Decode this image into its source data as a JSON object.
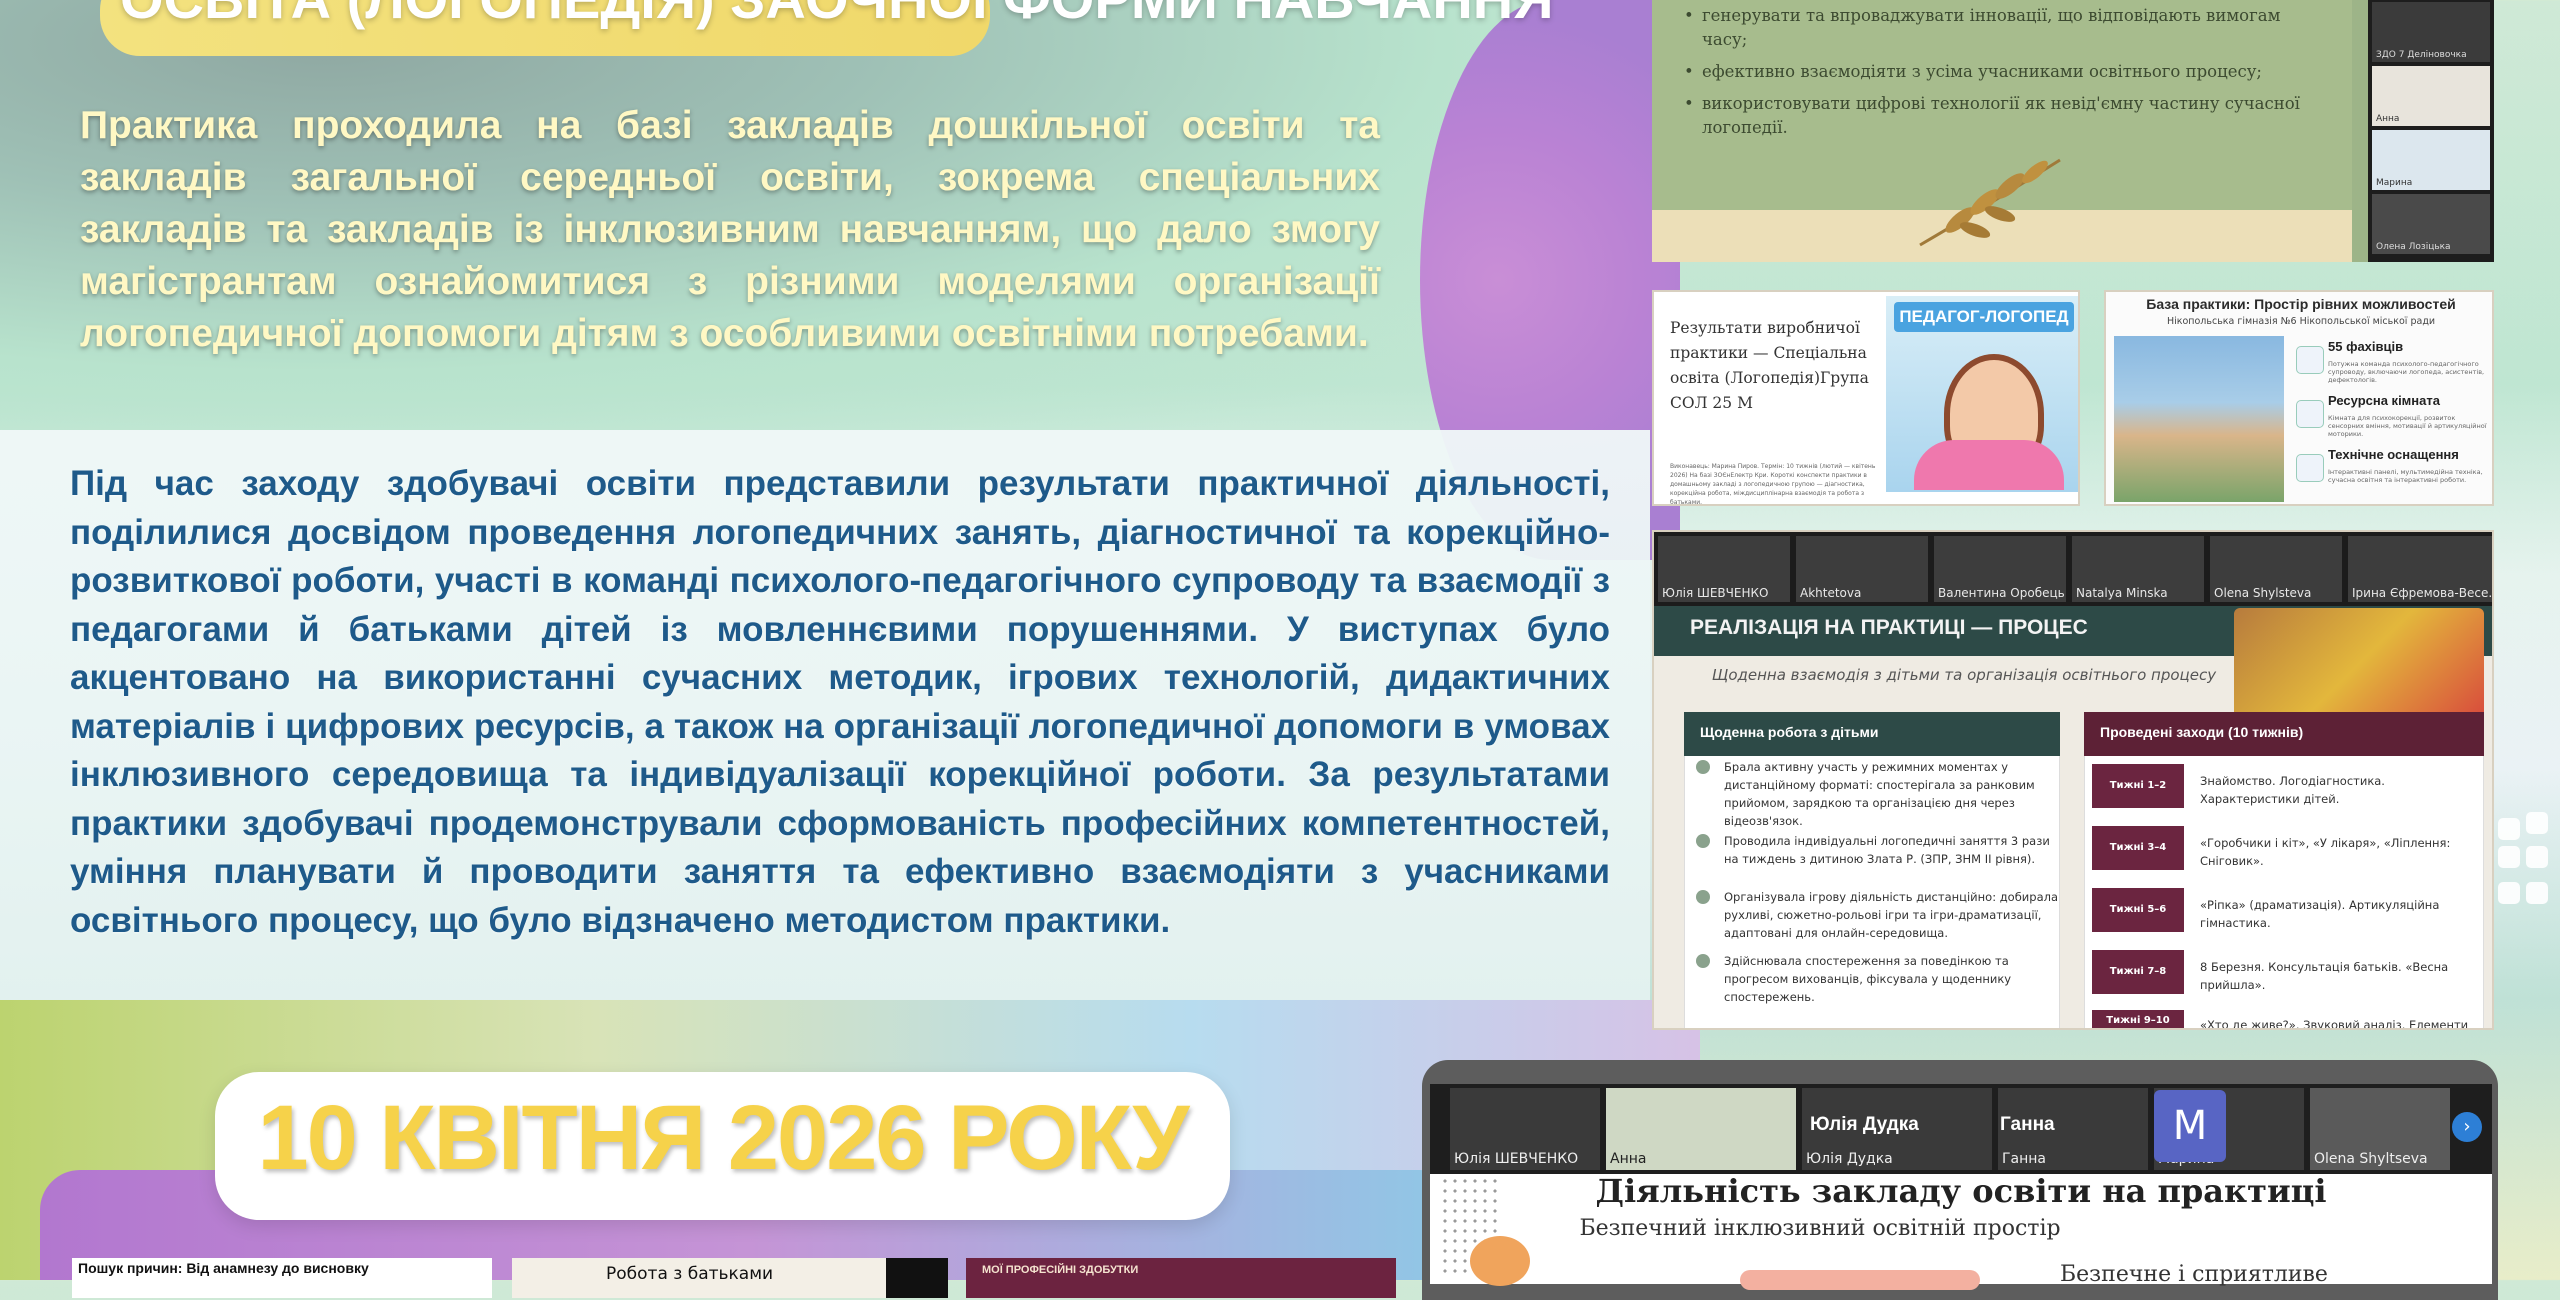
{
  "header": {
    "title": "ОСВІТА (ЛОГОПЕДІЯ) ЗАОЧНОЇ ФОРМИ НАВЧАННЯ",
    "intro": "Практика проходила на базі закладів дошкільної освіти та закладів загальної середньої освіти, зокрема спеціальних закладів та закладів із інклюзивним навчанням, що дало змогу магістрантам ознайомитися з різними моделями організації логопедичної допомоги дітям з особливими освітніми потребами."
  },
  "main": {
    "text": "Під час заходу здобувачі освіти представили результати практичної діяльності, поділилися досвідом проведення логопедичних занять, діагностичної та корекційно-розвиткової роботи, участі в команді психолого-педагогічного супроводу та взаємодії з педагогами й батьками дітей із мовленнєвими порушеннями. У виступах було акцентовано на використанні сучасних методик, ігрових технологій, дидактичних матеріалів і цифрових ресурсів, а також на організації логопедичної допомоги в умовах інклюзивного середовища та індивідуалізації корекційної роботи. За результатами практики здобувачі продемонстрували сформованість професійних компетентностей, уміння планувати й проводити заняття та ефективно взаємодіяти з учасниками освітнього процесу, що було відзначено методистом практики."
  },
  "date": "10 КВІТНЯ 2026 РОКУ",
  "slide1": {
    "bullets": [
      "генерувати та впроваджувати інновації, що відповідають вимогам часу;",
      "ефективно взаємодіяти з усіма учасниками освітнього процесу;",
      "використовувати цифрові технології як невід'ємну частину сучасної логопедії."
    ],
    "participants": [
      "ЗДО 7 Деліновочка",
      "Анна",
      "Марина",
      "Олена Лозіцька"
    ]
  },
  "slide2": {
    "text": "Результати виробничої практики — Спеціальна освіта (Логопедія)Група СОЛ 25 М",
    "small": "Виконавець: Марина Пиров. Термін: 10 тижнів (лютий — квітень 2026) На базі ЗОЄнЕлектр Кри. Короткі конспекти практики в домашньому закладі з логопедичною групою — діагностика, корекційна робота, міждисциплінарна взаємодія та робота з батьками.",
    "image_label": "ПЕДАГОГ-ЛОГОПЕД"
  },
  "slide3": {
    "title": "База практики: Простір рівних можливостей",
    "subtitle": "Нікопольська гімназія №6 Нікопольської міської ради",
    "rows": [
      {
        "head": "55 фахівців",
        "desc": "Потужна команда психолого-педагогічного супроводу, включаючи логопеда, асистентів, дефектологів."
      },
      {
        "head": "Ресурсна кімната",
        "desc": "Кімната для психокорекції, розвиток сенсорних вміння, мотивації й артикуляційної моторики."
      },
      {
        "head": "Технічне оснащення",
        "desc": "Інтерактивні панелі, мультимедійна техніка, сучасна освітня та інтерактивні роботи."
      }
    ]
  },
  "slide4": {
    "participants": [
      "Юлія ШЕВЧЕНКО",
      "Akhtetova",
      "Валентина Оробець",
      "Natalya Minska",
      "Olena Shylsteva",
      "Ірина Єфремова-Весе..."
    ],
    "heading": "РЕАЛІЗАЦІЯ НА ПРАКТИЦІ — ПРОЦЕС",
    "subheading": "Щоденна взаємодія з дітьми та організація освітнього процесу",
    "left_title": "Щоденна робота з дітьми",
    "left_items": [
      "Брала активну участь у режимних моментах у дистанційному форматі: спостерігала за ранковим прийомом, зарядкою та організацією дня через відеозв'язок.",
      "Проводила індивідуальні логопедичні заняття 3 рази на тиждень з дитиною Злата Р. (ЗПР, ЗНМ ІІ рівня).",
      "Організувала ігрову діяльність дистанційно: добирала рухливі, сюжетно-рольові ігри та ігри-драматизації, адаптовані для онлайн-середовища.",
      "Здійснювала спостереження за поведінкою та прогресом вихованців, фіксувала у щоденнику спостережень."
    ],
    "right_title": "Проведені заходи (10 тижнів)",
    "weeks": [
      {
        "label": "Тижні 1–2",
        "text": "Знайомство. Логодіагностика. Характеристики дітей."
      },
      {
        "label": "Тижні 3–4",
        "text": "«Горобчики і кіт», «У лікаря», «Ліплення: Сніговик»."
      },
      {
        "label": "Тижні 5–6",
        "text": "«Ріпка» (драматизація). Артикуляційна гімнастика."
      },
      {
        "label": "Тижні 7–8",
        "text": "8 Березня. Консультація батьків. «Весна прийшла»."
      },
      {
        "label": "Тижні 9–10",
        "text": "«Хто де живе?». Звуковий аналіз. Елементи"
      }
    ]
  },
  "slide5": {
    "participants": [
      "Юлія ШЕВЧЕНКО",
      "Анна",
      "Юлія Дудка",
      "Ганна",
      "Марина",
      "Olena Shyltseva"
    ],
    "big_names": [
      "Юлія Дудка",
      "Ганна"
    ],
    "avatar_letter": "M",
    "title": "Діяльність закладу освіти на практиці",
    "subtitle": "Безпечний інклюзивний освітній простір",
    "text2": "Безпечне і сприятливе"
  },
  "mini": {
    "m1": "Пошук причин: Від анамнезу до висновку",
    "m2": "Робота з батьками",
    "m3": "МОЇ ПРОФЕСІЙНІ ЗДОБУТКИ"
  }
}
